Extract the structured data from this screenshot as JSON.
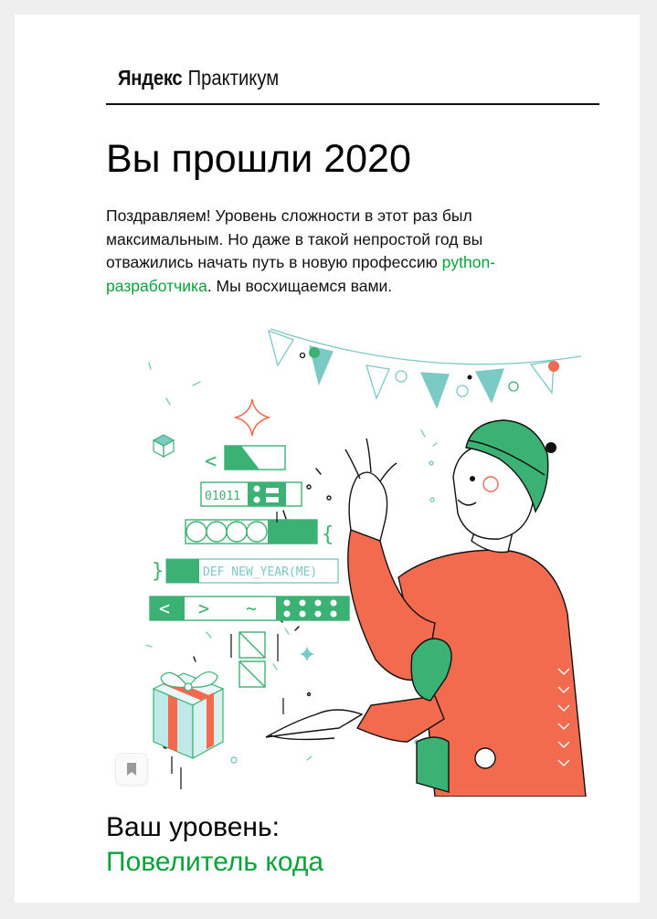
{
  "header": {
    "logo_brand": "Яндекс",
    "logo_product": "Практикум"
  },
  "main": {
    "headline": "Вы прошли 2020",
    "lead_before": "Поздравляем! Уровень сложности в этот раз был максимальным. Но даже в такой непростой год вы отважились начать путь в новую профессию ",
    "lead_accent": "python-разработчика",
    "lead_after": ". Мы восхищаемся вами."
  },
  "illustration": {
    "code_line_binary": "01011",
    "code_line_def": "DEF NEW_YEAR(ME)",
    "code_left_brace": "}",
    "code_right_brace": "{",
    "code_lt": "<",
    "code_gt": ">",
    "code_tilde": "~"
  },
  "level": {
    "label": "Ваш уровень:",
    "value": "Повелитель кода"
  },
  "icons": {
    "bookmark": "bookmark-icon"
  },
  "colors": {
    "accent_green": "#0ba23b",
    "illus_green": "#3bb273",
    "illus_red": "#f26b4e",
    "illus_teal": "#7ccac6",
    "background": "#efefef"
  }
}
